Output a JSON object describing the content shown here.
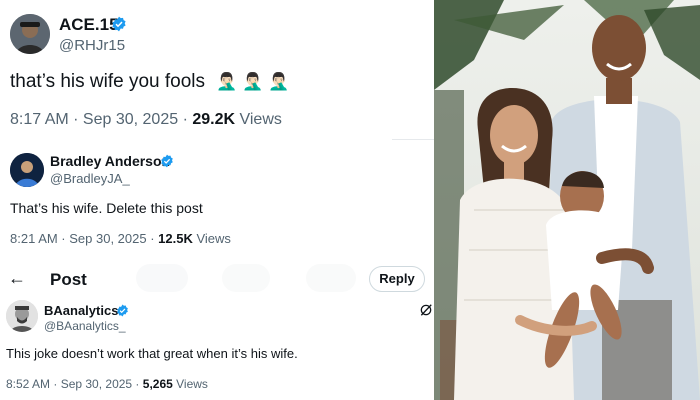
{
  "tweet1": {
    "name": "ACE.15",
    "handle": "@RHJr15",
    "text": "that’s his wife you fools",
    "emoji": "🤦🏻‍♂️ 🤦🏻‍♂️ 🤦🏻‍♂️",
    "time": "8:17 AM · Sep 30, 2025 · ",
    "views_count": "29.2K",
    "views_label": " Views"
  },
  "tweet2": {
    "name": "Bradley Anderson",
    "handle": "@BradleyJA_",
    "text": "That’s his wife. Delete this post",
    "time": "8:21 AM · Sep 30, 2025 · ",
    "views_count": "12.5K",
    "views_label": " Views"
  },
  "post_header": {
    "back_icon": "←",
    "title": "Post",
    "reply_label": "Reply"
  },
  "tweet3": {
    "name": "BAanalytics",
    "handle": "@BAanalytics_",
    "text": "This joke doesn’t work that great when it’s his wife.",
    "time": "8:52 AM · Sep 30, 2025 · ",
    "views_count": "5,265",
    "views_label": " Views"
  },
  "colors": {
    "verified": "#1d9bf0",
    "text": "#0f1419",
    "muted": "#536471"
  },
  "icons": [
    "verified-badge-icon",
    "back-arrow-icon",
    "grok-icon"
  ]
}
